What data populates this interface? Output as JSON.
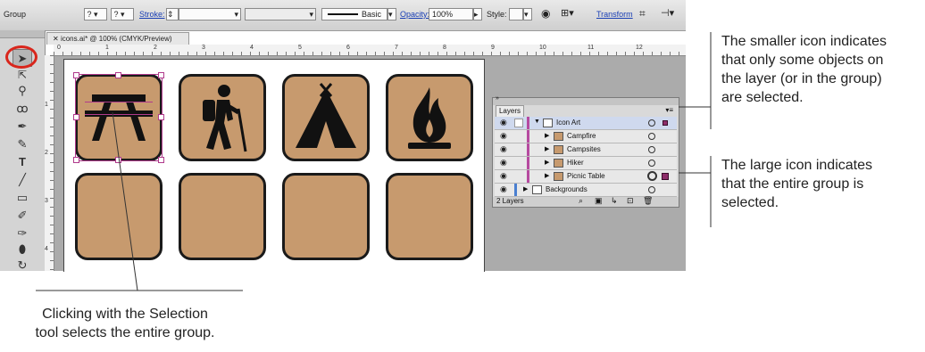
{
  "control_bar": {
    "mode_label": "Group",
    "stroke_label": "Stroke:",
    "stroke_value": "",
    "brush_label": "Basic",
    "opacity_label": "Opacity:",
    "opacity_value": "100%",
    "style_label": "Style:",
    "transform_label": "Transform"
  },
  "document": {
    "tab_title": "icons.ai* @ 100% (CMYK/Preview)",
    "ruler_numbers": [
      "0",
      "1",
      "2",
      "3",
      "4",
      "5",
      "6",
      "7",
      "8",
      "9",
      "10",
      "11",
      "12"
    ]
  },
  "icons": [
    "picnic-table-icon",
    "hiker-icon",
    "campsite-tent-icon",
    "campfire-icon"
  ],
  "layers_panel": {
    "tab_label": "Layers",
    "rows": [
      {
        "name": "Icon Art",
        "level": 0,
        "expanded": true
      },
      {
        "name": "Campfire",
        "level": 1
      },
      {
        "name": "Campsites",
        "level": 1
      },
      {
        "name": "Hiker",
        "level": 1
      },
      {
        "name": "Picnic Table",
        "level": 1
      },
      {
        "name": "Backgrounds",
        "level": 0
      }
    ],
    "footer_count": "2 Layers"
  },
  "callouts": {
    "small_icon": [
      "The smaller icon indicates",
      "that only some objects on",
      "the layer (or in the group)",
      "are selected."
    ],
    "large_icon": [
      "The large icon indicates",
      "that the entire group is",
      "selected."
    ],
    "selection_tool": [
      "Clicking with the Selection",
      "tool selects the entire group."
    ]
  },
  "colors": {
    "tile_fill": "#c79a6e",
    "selection_color": "#8e2d6a",
    "highlight_circle": "#d9261c",
    "link_color": "#1a3fb5"
  }
}
